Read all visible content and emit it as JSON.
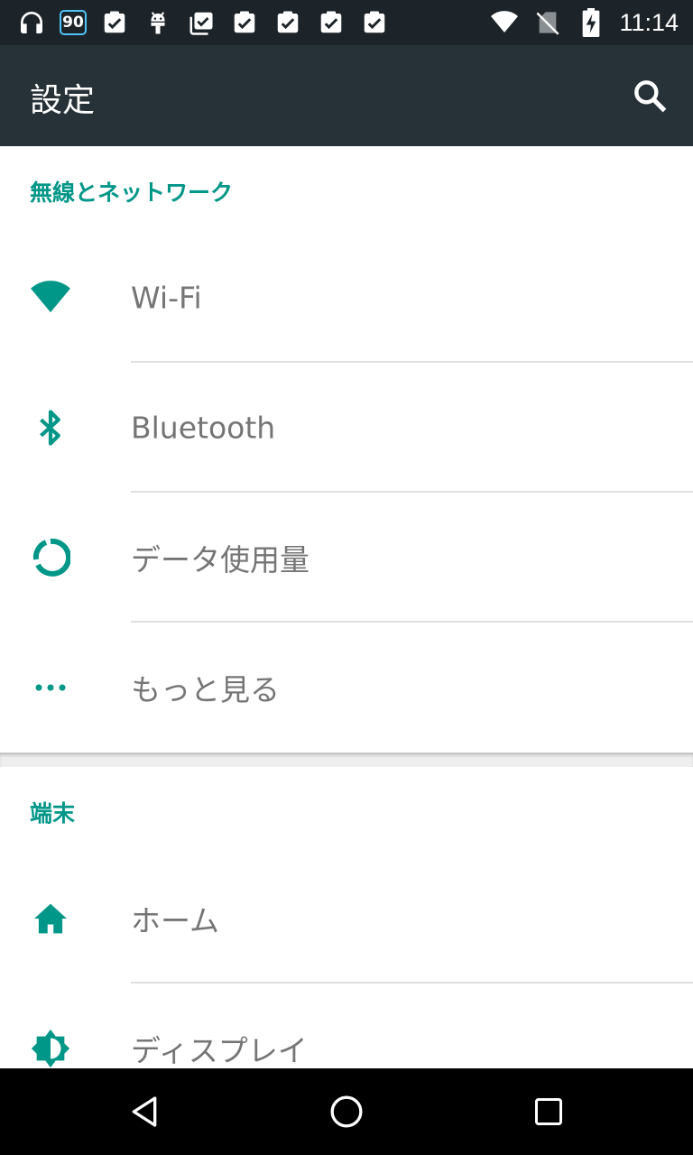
{
  "status_bar": {
    "time": "11:14",
    "notification_badge": "90",
    "icons_left": [
      "headphones-icon",
      "badge-90-icon",
      "clipboard-check-icon",
      "android-icon",
      "clipboard-stack-check-icon",
      "clipboard-check-icon",
      "clipboard-check-icon",
      "clipboard-check-icon",
      "clipboard-check-icon"
    ],
    "icons_right": [
      "wifi-icon",
      "no-sim-icon",
      "battery-charging-icon"
    ]
  },
  "toolbar": {
    "title": "設定",
    "search_icon": "search-icon"
  },
  "sections": [
    {
      "header": "無線とネットワーク",
      "items": [
        {
          "label": "Wi-Fi",
          "icon": "wifi-icon"
        },
        {
          "label": "Bluetooth",
          "icon": "bluetooth-icon"
        },
        {
          "label": "データ使用量",
          "icon": "data-usage-icon"
        },
        {
          "label": "もっと見る",
          "icon": "more-dots-icon"
        }
      ]
    },
    {
      "header": "端末",
      "items": [
        {
          "label": "ホーム",
          "icon": "home-icon"
        },
        {
          "label": "ディスプレイ",
          "icon": "brightness-icon"
        }
      ]
    }
  ],
  "nav_bar": {
    "back": "back-icon",
    "home": "home-circle-icon",
    "recents": "recents-icon"
  },
  "colors": {
    "accent": "#009688",
    "toolbar": "#263238",
    "status_bar": "#1d2429",
    "text": "#757575"
  }
}
